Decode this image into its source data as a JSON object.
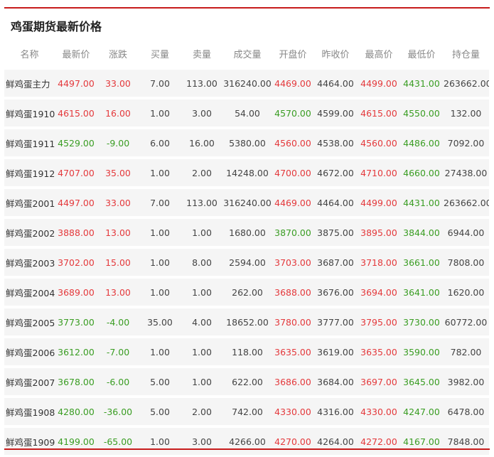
{
  "title": "鸡蛋期货最新价格",
  "columns": [
    "名称",
    "最新价",
    "涨跌",
    "买量",
    "卖量",
    "成交量",
    "开盘价",
    "昨收价",
    "最高价",
    "最低价",
    "持仓量"
  ],
  "colors": {
    "up": "#e4393c",
    "down": "#3a9d23",
    "accent": "#c71c1c"
  },
  "rows": [
    {
      "name": "鲜鸡蛋主力",
      "last": "4497.00",
      "change": "33.00",
      "bid": "7.00",
      "ask": "113.00",
      "volume": "316240.00",
      "open": "4469.00",
      "prev": "4464.00",
      "high": "4499.00",
      "low": "4431.00",
      "oi": "263662.00"
    },
    {
      "name": "鲜鸡蛋1910",
      "last": "4615.00",
      "change": "16.00",
      "bid": "1.00",
      "ask": "3.00",
      "volume": "54.00",
      "open": "4570.00",
      "prev": "4599.00",
      "high": "4615.00",
      "low": "4550.00",
      "oi": "132.00"
    },
    {
      "name": "鲜鸡蛋1911",
      "last": "4529.00",
      "change": "-9.00",
      "bid": "6.00",
      "ask": "16.00",
      "volume": "5380.00",
      "open": "4560.00",
      "prev": "4538.00",
      "high": "4560.00",
      "low": "4486.00",
      "oi": "7092.00"
    },
    {
      "name": "鲜鸡蛋1912",
      "last": "4707.00",
      "change": "35.00",
      "bid": "1.00",
      "ask": "2.00",
      "volume": "14248.00",
      "open": "4700.00",
      "prev": "4672.00",
      "high": "4710.00",
      "low": "4660.00",
      "oi": "27438.00"
    },
    {
      "name": "鲜鸡蛋2001",
      "last": "4497.00",
      "change": "33.00",
      "bid": "7.00",
      "ask": "113.00",
      "volume": "316240.00",
      "open": "4469.00",
      "prev": "4464.00",
      "high": "4499.00",
      "low": "4431.00",
      "oi": "263662.00"
    },
    {
      "name": "鲜鸡蛋2002",
      "last": "3888.00",
      "change": "13.00",
      "bid": "1.00",
      "ask": "1.00",
      "volume": "1680.00",
      "open": "3870.00",
      "prev": "3875.00",
      "high": "3895.00",
      "low": "3844.00",
      "oi": "6944.00"
    },
    {
      "name": "鲜鸡蛋2003",
      "last": "3702.00",
      "change": "15.00",
      "bid": "1.00",
      "ask": "8.00",
      "volume": "2594.00",
      "open": "3703.00",
      "prev": "3687.00",
      "high": "3718.00",
      "low": "3661.00",
      "oi": "7808.00"
    },
    {
      "name": "鲜鸡蛋2004",
      "last": "3689.00",
      "change": "13.00",
      "bid": "1.00",
      "ask": "1.00",
      "volume": "262.00",
      "open": "3688.00",
      "prev": "3676.00",
      "high": "3694.00",
      "low": "3641.00",
      "oi": "1620.00"
    },
    {
      "name": "鲜鸡蛋2005",
      "last": "3773.00",
      "change": "-4.00",
      "bid": "35.00",
      "ask": "4.00",
      "volume": "18652.00",
      "open": "3780.00",
      "prev": "3777.00",
      "high": "3795.00",
      "low": "3730.00",
      "oi": "60772.00"
    },
    {
      "name": "鲜鸡蛋2006",
      "last": "3612.00",
      "change": "-7.00",
      "bid": "1.00",
      "ask": "1.00",
      "volume": "118.00",
      "open": "3635.00",
      "prev": "3619.00",
      "high": "3635.00",
      "low": "3590.00",
      "oi": "782.00"
    },
    {
      "name": "鲜鸡蛋2007",
      "last": "3678.00",
      "change": "-6.00",
      "bid": "5.00",
      "ask": "1.00",
      "volume": "622.00",
      "open": "3686.00",
      "prev": "3684.00",
      "high": "3697.00",
      "low": "3645.00",
      "oi": "3982.00"
    },
    {
      "name": "鲜鸡蛋1908",
      "last": "4280.00",
      "change": "-36.00",
      "bid": "5.00",
      "ask": "2.00",
      "volume": "742.00",
      "open": "4330.00",
      "prev": "4316.00",
      "high": "4330.00",
      "low": "4247.00",
      "oi": "6478.00"
    },
    {
      "name": "鲜鸡蛋1909",
      "last": "4199.00",
      "change": "-65.00",
      "bid": "1.00",
      "ask": "3.00",
      "volume": "4266.00",
      "open": "4270.00",
      "prev": "4264.00",
      "high": "4272.00",
      "low": "4167.00",
      "oi": "7848.00"
    }
  ]
}
